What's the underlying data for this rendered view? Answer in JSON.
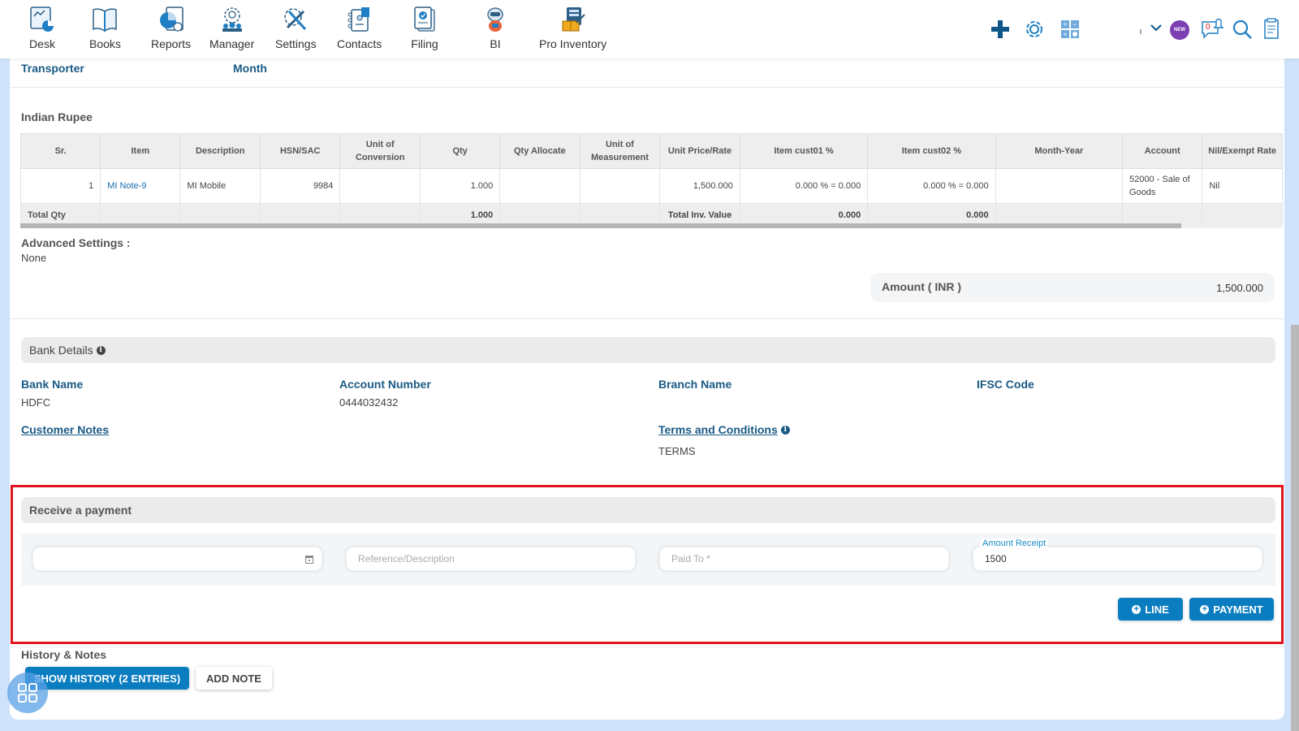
{
  "nav": {
    "items": [
      {
        "label": "Desk",
        "icon": "desk-icon"
      },
      {
        "label": "Books",
        "icon": "books-icon"
      },
      {
        "label": "Reports",
        "icon": "reports-icon"
      },
      {
        "label": "Manager",
        "icon": "manager-icon"
      },
      {
        "label": "Settings",
        "icon": "settings-icon"
      },
      {
        "label": "Contacts",
        "icon": "contacts-icon"
      },
      {
        "label": "Filing",
        "icon": "filing-icon"
      },
      {
        "label": "BI",
        "icon": "bi-robot-icon"
      },
      {
        "label": "Pro Inventory",
        "icon": "pro-inventory-icon"
      }
    ],
    "right_icons": [
      "plus-icon",
      "gear-icon",
      "calculator-icon",
      "chevron-down-icon",
      "new-badge-icon",
      "notification-icon",
      "search-icon",
      "document-icon"
    ],
    "new_badge": "NEW",
    "notification_count": "0"
  },
  "header_fields": {
    "transporter_label": "Transporter",
    "month_label": "Month"
  },
  "currency": "Indian Rupee",
  "table": {
    "columns": [
      "Sr.",
      "Item",
      "Description",
      "HSN/SAC",
      "Unit of Conversion",
      "Qty",
      "Qty Allocate",
      "Unit of Measurement",
      "Unit Price/Rate",
      "Item cust01 %",
      "Item cust02 %",
      "Month-Year",
      "Account",
      "Nil/Exempt Rate"
    ],
    "rows": [
      {
        "sr": "1",
        "item": "MI Note-9",
        "description": "MI Mobile",
        "hsn": "9984",
        "unit_conversion": "",
        "qty": "1.000",
        "qty_allocate": "",
        "uom": "",
        "unit_price": "1,500.000",
        "cust01": "0.000 % = 0.000",
        "cust02": "0.000 % = 0.000",
        "month_year": "",
        "account": "52000 - Sale of Goods",
        "nil_exempt": "Nil"
      }
    ],
    "total": {
      "label": "Total Qty",
      "qty": "1.000",
      "inv_label": "Total Inv. Value",
      "cust01": "0.000",
      "cust02": "0.000"
    }
  },
  "advanced_settings": {
    "label": "Advanced Settings :",
    "value": "None"
  },
  "amount": {
    "label": "Amount ( INR )",
    "value": "1,500.000"
  },
  "bank": {
    "title": "Bank Details",
    "bank_name_label": "Bank Name",
    "bank_name": "HDFC",
    "account_number_label": "Account Number",
    "account_number": "0444032432",
    "branch_name_label": "Branch Name",
    "branch_name": "",
    "ifsc_label": "IFSC Code",
    "ifsc": ""
  },
  "customer_notes_label": "Customer Notes",
  "terms": {
    "label": "Terms and Conditions",
    "value": "TERMS"
  },
  "payment": {
    "title": "Receive a payment",
    "date_value": "",
    "reference_placeholder": "Reference/Description",
    "paid_to_placeholder": "Paid To *",
    "amount_label": "Amount Receipt",
    "amount_value": "1500",
    "line_button": "LINE",
    "payment_button": "PAYMENT"
  },
  "history": {
    "title": "History & Notes",
    "show_history_button": "SHOW HISTORY (2 ENTRIES)",
    "add_note_button": "ADD NOTE"
  },
  "colors": {
    "accent": "#0a7dc1",
    "label_blue": "#1a5a85",
    "highlight_red": "#e0161e"
  }
}
